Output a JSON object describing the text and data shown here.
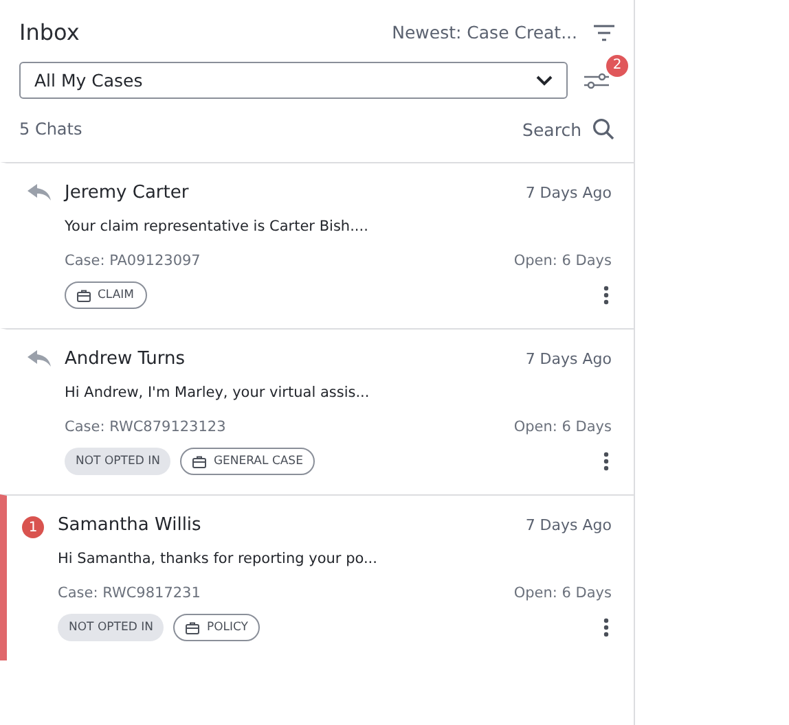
{
  "header": {
    "title": "Inbox",
    "sort_label": "Newest: Case Creat..."
  },
  "filter": {
    "value": "All My Cases",
    "badge": "2"
  },
  "count_label": "5 Chats",
  "search_label": "Search",
  "chats": [
    {
      "name": "Jeremy Carter",
      "time": "7 Days Ago",
      "preview": "Your claim representative is Carter Bish....",
      "case": "Case: PA09123097",
      "open": "Open: 6 Days",
      "kind": "replied",
      "flagged": false,
      "tags": [
        {
          "kind": "type",
          "label": "CLAIM"
        }
      ]
    },
    {
      "name": "Andrew Turns",
      "time": "7 Days Ago",
      "preview": "Hi Andrew, I'm Marley, your virtual assis...",
      "case": "Case: RWC879123123",
      "open": "Open: 6 Days",
      "kind": "replied",
      "flagged": false,
      "tags": [
        {
          "kind": "status",
          "label": "NOT OPTED IN"
        },
        {
          "kind": "type",
          "label": "GENERAL CASE"
        }
      ]
    },
    {
      "name": "Samantha Willis",
      "time": "7 Days Ago",
      "preview": "Hi Samantha, thanks for reporting your po...",
      "case": "Case: RWC9817231",
      "open": "Open: 6 Days",
      "kind": "unread",
      "unread": "1",
      "flagged": true,
      "tags": [
        {
          "kind": "status",
          "label": "NOT OPTED IN"
        },
        {
          "kind": "type",
          "label": "POLICY"
        }
      ]
    }
  ]
}
